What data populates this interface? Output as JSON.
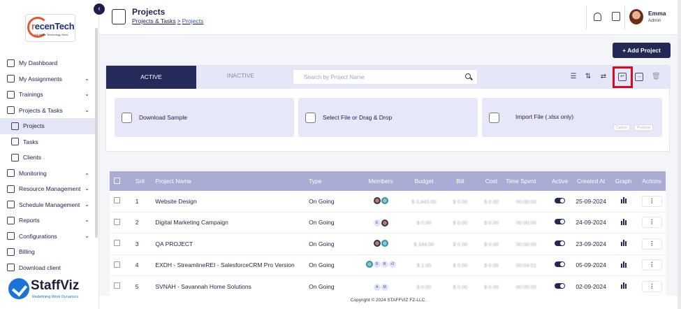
{
  "brand": {
    "logo_text": "recenTech",
    "logo_tagline": "We Make Technology Work",
    "footer_logo": "StaffViz",
    "footer_tagline": "Redefining Work Dynamics"
  },
  "sidebar": {
    "items": [
      {
        "label": "My Dashboard",
        "icon": "dashboard-icon",
        "chevron": false
      },
      {
        "label": "My Assignments",
        "icon": "assignments-icon",
        "chevron": true
      },
      {
        "label": "Trainings",
        "icon": "training-icon",
        "chevron": true
      },
      {
        "label": "Projects & Tasks",
        "icon": "projects-tasks-icon",
        "chevron": true
      },
      {
        "label": "Projects",
        "icon": "projects-icon",
        "sub": true,
        "active": true
      },
      {
        "label": "Tasks",
        "icon": "tasks-icon",
        "sub": true
      },
      {
        "label": "Clients",
        "icon": "clients-icon",
        "sub": true
      },
      {
        "label": "Monitoring",
        "icon": "monitoring-icon",
        "chevron": true
      },
      {
        "label": "Resource Management",
        "icon": "resource-icon",
        "chevron": true
      },
      {
        "label": "Schedule Management",
        "icon": "schedule-icon",
        "chevron": true
      },
      {
        "label": "Reports",
        "icon": "reports-icon",
        "chevron": true
      },
      {
        "label": "Configurations",
        "icon": "config-icon",
        "chevron": true
      },
      {
        "label": "Billing",
        "icon": "billing-icon",
        "chevron": false
      },
      {
        "label": "Download client",
        "icon": "download-icon",
        "chevron": false
      }
    ]
  },
  "header": {
    "title": "Projects",
    "breadcrumb_parent": "Projects & Tasks",
    "breadcrumb_sep": ">",
    "breadcrumb_current": "Projects",
    "user_name": "Emma",
    "user_role": "Admin"
  },
  "toolbar": {
    "add_project": "+ Add Project",
    "tab_active": "ACTIVE",
    "tab_inactive": "INACTIVE",
    "search_placeholder": "Search by Project Name"
  },
  "import": {
    "download_sample": "Download Sample",
    "select_file": "Select File or Drag & Drop",
    "import_file": "Import File (.xlsx only)",
    "cancel": "Cancel",
    "proceed": "Proceed"
  },
  "table": {
    "columns": [
      "Sr#",
      "Project Name",
      "Type",
      "Members",
      "Budget",
      "Bill",
      "Cost",
      "Time Spent",
      "Active",
      "Created At",
      "Graph",
      "Actions"
    ],
    "rows": [
      {
        "sr": "1",
        "name": "Website Design",
        "type": "On Going",
        "members": [
          "p",
          "g"
        ],
        "budget": "$ 3,443.00",
        "bill": "$ 0.00",
        "cost": "$ 0.00",
        "time": "00:00:00",
        "created": "25-09-2024"
      },
      {
        "sr": "2",
        "name": "Digital Marketing Campaign",
        "type": "On Going",
        "members": [
          "E",
          "p"
        ],
        "budget": "$ 0.00",
        "bill": "$ 0.00",
        "cost": "$ 0.00",
        "time": "00:00:00",
        "created": "24-09-2024"
      },
      {
        "sr": "3",
        "name": "QA PROJECT",
        "type": "On Going",
        "members": [
          "p",
          "g"
        ],
        "budget": "$ 344.00",
        "bill": "$ 0.00",
        "cost": "$ 0.00",
        "time": "00:00:00",
        "created": "23-09-2024"
      },
      {
        "sr": "4",
        "name": "EXDH - StreamlineREI - SalesforceCRM Pro Version",
        "type": "On Going",
        "members": [
          "g",
          "R",
          "B",
          "+2"
        ],
        "budget": "$ 1.00",
        "bill": "$ 0.00",
        "cost": "$ 0.00",
        "time": "00:04:01",
        "created": "05-09-2024"
      },
      {
        "sr": "5",
        "name": "SVNAH - Savannah Home Solutions",
        "type": "On Going",
        "members": [
          "A",
          "M"
        ],
        "budget": "$ 0.00",
        "bill": "$ 0.00",
        "cost": "$ 0.00",
        "time": "00:00:00",
        "created": "02-09-2024"
      }
    ]
  },
  "footer": {
    "copyright": "Copyright © 2024 STAFFVIZ FZ-LLC."
  },
  "colors": {
    "primary": "#232857",
    "header_row": "#a9acd5",
    "highlight": "#e3061b",
    "upload_card": "#e6e7f8"
  }
}
